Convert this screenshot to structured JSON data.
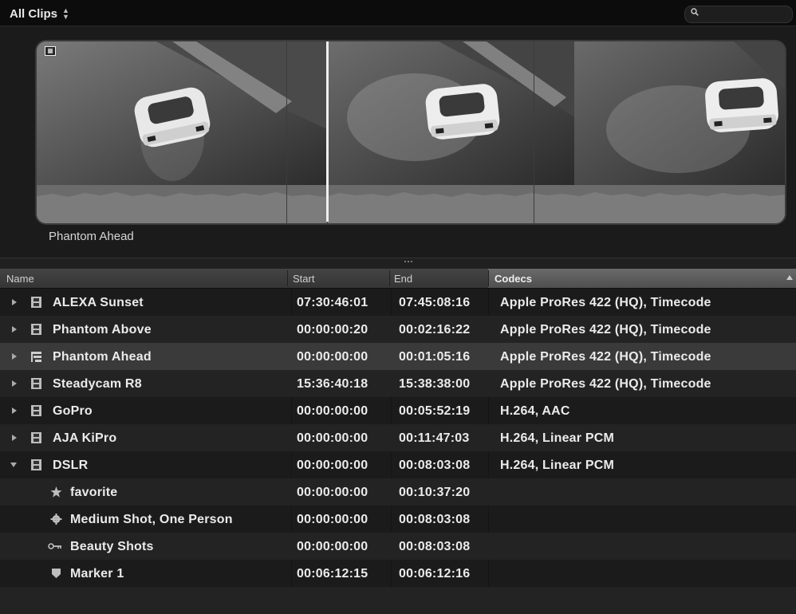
{
  "toolbar": {
    "clips_filter": "All Clips",
    "search_placeholder": ""
  },
  "preview": {
    "clip_title": "Phantom Ahead",
    "frames": [
      "car-drift-frame-1",
      "car-drift-frame-2",
      "car-drift-frame-3"
    ]
  },
  "list": {
    "columns": {
      "name": "Name",
      "start": "Start",
      "end": "End",
      "codecs": "Codecs"
    },
    "rows": [
      {
        "name": "ALEXA Sunset",
        "start": "07:30:46:01",
        "end": "07:45:08:16",
        "codecs": "Apple ProRes 422 (HQ), Timecode",
        "icon": "filmstrip-icon",
        "expanded": false
      },
      {
        "name": "Phantom Above",
        "start": "00:00:00:20",
        "end": "00:02:16:22",
        "codecs": "Apple ProRes 422 (HQ), Timecode",
        "icon": "filmstrip-icon",
        "expanded": false
      },
      {
        "name": "Phantom Ahead",
        "start": "00:00:00:00",
        "end": "00:01:05:16",
        "codecs": "Apple ProRes 422 (HQ), Timecode",
        "icon": "compound-clip-icon",
        "expanded": false,
        "selected": true
      },
      {
        "name": "Steadycam R8",
        "start": "15:36:40:18",
        "end": "15:38:38:00",
        "codecs": "Apple ProRes 422 (HQ), Timecode",
        "icon": "filmstrip-icon",
        "expanded": false
      },
      {
        "name": "GoPro",
        "start": "00:00:00:00",
        "end": "00:05:52:19",
        "codecs": "H.264, AAC",
        "icon": "filmstrip-icon",
        "expanded": false
      },
      {
        "name": "AJA KiPro",
        "start": "00:00:00:00",
        "end": "00:11:47:03",
        "codecs": "H.264, Linear PCM",
        "icon": "filmstrip-icon",
        "expanded": false
      },
      {
        "name": "DSLR",
        "start": "00:00:00:00",
        "end": "00:08:03:08",
        "codecs": "H.264, Linear PCM",
        "icon": "filmstrip-icon",
        "expanded": true
      },
      {
        "name": "favorite",
        "start": "00:00:00:00",
        "end": "00:10:37:20",
        "codecs": "",
        "icon": "star-icon",
        "child": true
      },
      {
        "name": "Medium Shot, One Person",
        "start": "00:00:00:00",
        "end": "00:08:03:08",
        "codecs": "",
        "icon": "gear-icon",
        "child": true
      },
      {
        "name": "Beauty Shots",
        "start": "00:00:00:00",
        "end": "00:08:03:08",
        "codecs": "",
        "icon": "keyword-icon",
        "child": true
      },
      {
        "name": "Marker 1",
        "start": "00:06:12:15",
        "end": "00:06:12:16",
        "codecs": "",
        "icon": "marker-icon",
        "child": true
      }
    ]
  }
}
